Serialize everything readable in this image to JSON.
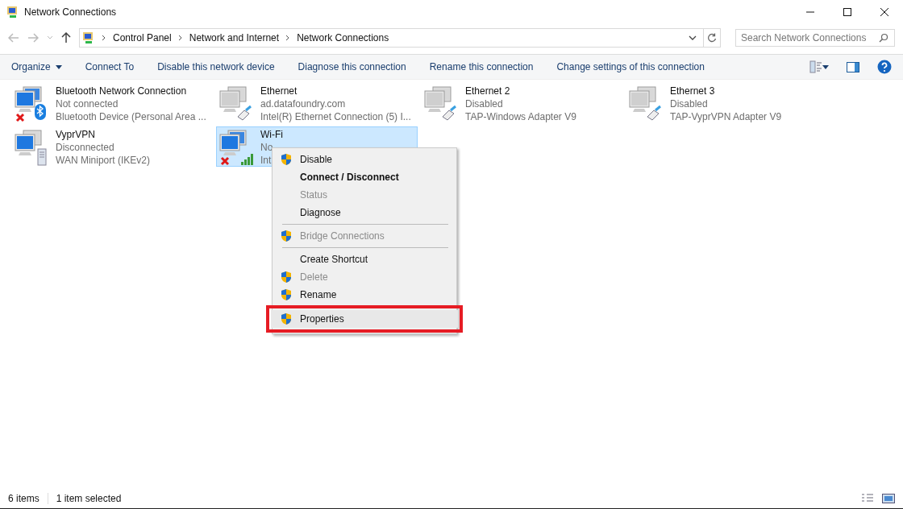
{
  "window": {
    "title": "Network Connections"
  },
  "breadcrumb": [
    "Control Panel",
    "Network and Internet",
    "Network Connections"
  ],
  "search": {
    "placeholder": "Search Network Connections"
  },
  "toolbar": [
    {
      "label": "Organize",
      "dropdown": true
    },
    {
      "label": "Connect To",
      "dropdown": false
    },
    {
      "label": "Disable this network device",
      "dropdown": false
    },
    {
      "label": "Diagnose this connection",
      "dropdown": false
    },
    {
      "label": "Rename this connection",
      "dropdown": false
    },
    {
      "label": "Change settings of this connection",
      "dropdown": false
    }
  ],
  "connections": [
    {
      "name": "Bluetooth Network Connection",
      "status": "Not connected",
      "device": "Bluetooth Device (Personal Area ...",
      "kind": "bluetooth",
      "error": true,
      "selected": false
    },
    {
      "name": "Ethernet",
      "status": "ad.datafoundry.com",
      "device": "Intel(R) Ethernet Connection (5) I...",
      "kind": "cable",
      "error": false,
      "selected": false
    },
    {
      "name": "Ethernet 2",
      "status": "Disabled",
      "device": "TAP-Windows Adapter V9",
      "kind": "cable",
      "error": false,
      "selected": false
    },
    {
      "name": "Ethernet 3",
      "status": "Disabled",
      "device": "TAP-VyprVPN Adapter V9",
      "kind": "cable",
      "error": false,
      "selected": false
    },
    {
      "name": "VyprVPN",
      "status": "Disconnected",
      "device": "WAN Miniport (IKEv2)",
      "kind": "server",
      "error": false,
      "selected": false
    },
    {
      "name": "Wi-Fi",
      "status": "No",
      "device": "Int",
      "kind": "wifi",
      "error": true,
      "selected": true
    }
  ],
  "context_menu": [
    {
      "kind": "item",
      "label": "Disable",
      "shield": true,
      "bold": false,
      "disabled": false,
      "highlighted": false
    },
    {
      "kind": "item",
      "label": "Connect / Disconnect",
      "shield": false,
      "bold": true,
      "disabled": false,
      "highlighted": false
    },
    {
      "kind": "item",
      "label": "Status",
      "shield": false,
      "bold": false,
      "disabled": true,
      "highlighted": false
    },
    {
      "kind": "item",
      "label": "Diagnose",
      "shield": false,
      "bold": false,
      "disabled": false,
      "highlighted": false
    },
    {
      "kind": "separator"
    },
    {
      "kind": "item",
      "label": "Bridge Connections",
      "shield": true,
      "bold": false,
      "disabled": true,
      "highlighted": false
    },
    {
      "kind": "separator"
    },
    {
      "kind": "item",
      "label": "Create Shortcut",
      "shield": false,
      "bold": false,
      "disabled": false,
      "highlighted": false
    },
    {
      "kind": "item",
      "label": "Delete",
      "shield": true,
      "bold": false,
      "disabled": true,
      "highlighted": false
    },
    {
      "kind": "item",
      "label": "Rename",
      "shield": true,
      "bold": false,
      "disabled": false,
      "highlighted": false
    },
    {
      "kind": "item",
      "label": "Properties",
      "shield": true,
      "bold": false,
      "disabled": false,
      "highlighted": true
    }
  ],
  "status_bar": {
    "count": "6 items",
    "selection": "1 item selected"
  }
}
